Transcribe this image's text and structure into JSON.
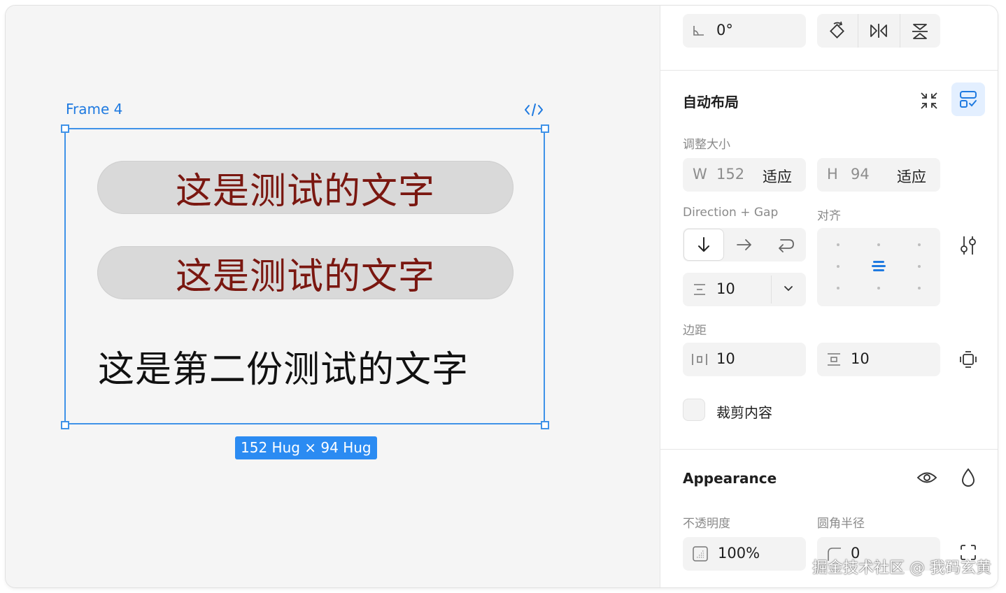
{
  "canvas": {
    "frame_label": "Frame 4",
    "pill_1_text": "这是测试的文字",
    "pill_2_text": "这是测试的文字",
    "plain_text": "这是第二份测试的文字",
    "size_tag": "152 Hug × 94 Hug",
    "colors": {
      "selection": "#3f92e8",
      "pill_bg": "#d9d9d9",
      "pill_text": "#7a1710",
      "tag_bg": "#2b8bf2"
    }
  },
  "rotation": {
    "value": "0°"
  },
  "auto_layout": {
    "title": "自动布局",
    "resize_label": "调整大小",
    "width_prefix": "W",
    "width_value": "152",
    "width_mode": "适应",
    "height_prefix": "H",
    "height_value": "94",
    "height_mode": "适应",
    "direction_gap_label": "Direction + Gap",
    "align_label": "对齐",
    "gap_value": "10",
    "padding_label": "边距",
    "padding_horizontal": "10",
    "padding_vertical": "10",
    "clip_content_label": "裁剪内容"
  },
  "appearance": {
    "title": "Appearance",
    "opacity_label": "不透明度",
    "opacity_value": "100%",
    "radius_label": "圆角半径",
    "radius_value": "0"
  },
  "watermark": "掘金技术社区 @ 我码玄黄"
}
